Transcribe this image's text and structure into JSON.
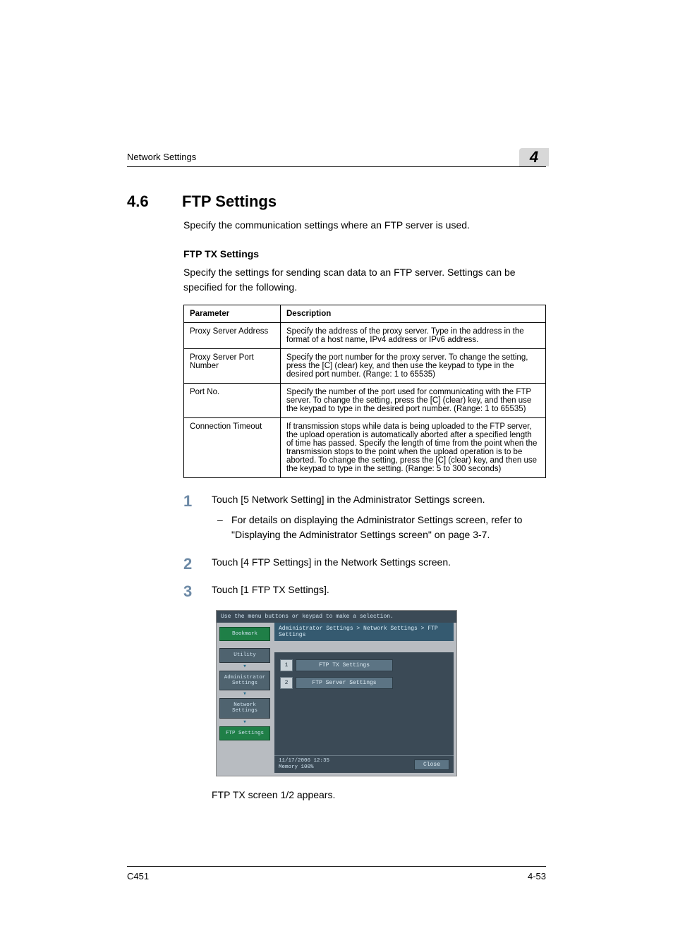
{
  "running_head": "Network Settings",
  "chapter_number": "4",
  "section": {
    "number": "4.6",
    "title": "FTP Settings",
    "intro": "Specify the communication settings where an FTP server is used."
  },
  "subsection": {
    "title": "FTP TX Settings",
    "intro": "Specify the settings for sending scan data to an FTP server. Settings can be specified for the following."
  },
  "table": {
    "headers": {
      "param": "Parameter",
      "desc": "Description"
    },
    "rows": [
      {
        "param": "Proxy Server Address",
        "desc": "Specify the address of the proxy server. Type in the address in the format of a host name, IPv4 address or IPv6 address."
      },
      {
        "param": "Proxy Server Port Number",
        "desc": "Specify the port number for the proxy server. To change the setting, press the [C] (clear) key, and then use the keypad to type in the desired port number. (Range: 1 to 65535)"
      },
      {
        "param": "Port No.",
        "desc": "Specify the number of the port used for communicating with the FTP server. To change the setting, press the [C] (clear) key, and then use the keypad to type in the desired port number. (Range: 1 to 65535)"
      },
      {
        "param": "Connection Timeout",
        "desc": "If transmission stops while data is being uploaded to the FTP server, the upload operation is automatically aborted after a specified length of time has passed. Specify the length of time from the point when the transmission stops to the point when the upload operation is to be aborted. To change the setting, press the [C] (clear) key, and then use the keypad to type in the setting. (Range: 5 to 300 seconds)"
      }
    ]
  },
  "steps": [
    {
      "text": "Touch [5 Network Setting] in the Administrator Settings screen.",
      "sub": [
        "For details on displaying the Administrator Settings screen, refer to \"Displaying the Administrator Settings screen\" on page 3-7."
      ]
    },
    {
      "text": "Touch [4 FTP Settings] in the Network Settings screen.",
      "sub": []
    },
    {
      "text": "Touch [1 FTP TX Settings].",
      "sub": []
    }
  ],
  "panel": {
    "hint": "Use the menu buttons or keypad to make a selection.",
    "path": "Administrator Settings > Network Settings > FTP Settings",
    "sidebar": {
      "bookmark": "Bookmark",
      "utility": "Utility",
      "admin": "Administrator Settings",
      "network": "Network Settings",
      "ftp": "FTP Settings"
    },
    "options": [
      {
        "num": "1",
        "label": "FTP TX Settings"
      },
      {
        "num": "2",
        "label": "FTP Server Settings"
      }
    ],
    "datetime": "11/17/2006   12:35",
    "memory": "Memory        100%",
    "close": "Close"
  },
  "after_panel": "FTP TX screen 1/2 appears.",
  "footer": {
    "left": "C451",
    "right": "4-53"
  }
}
